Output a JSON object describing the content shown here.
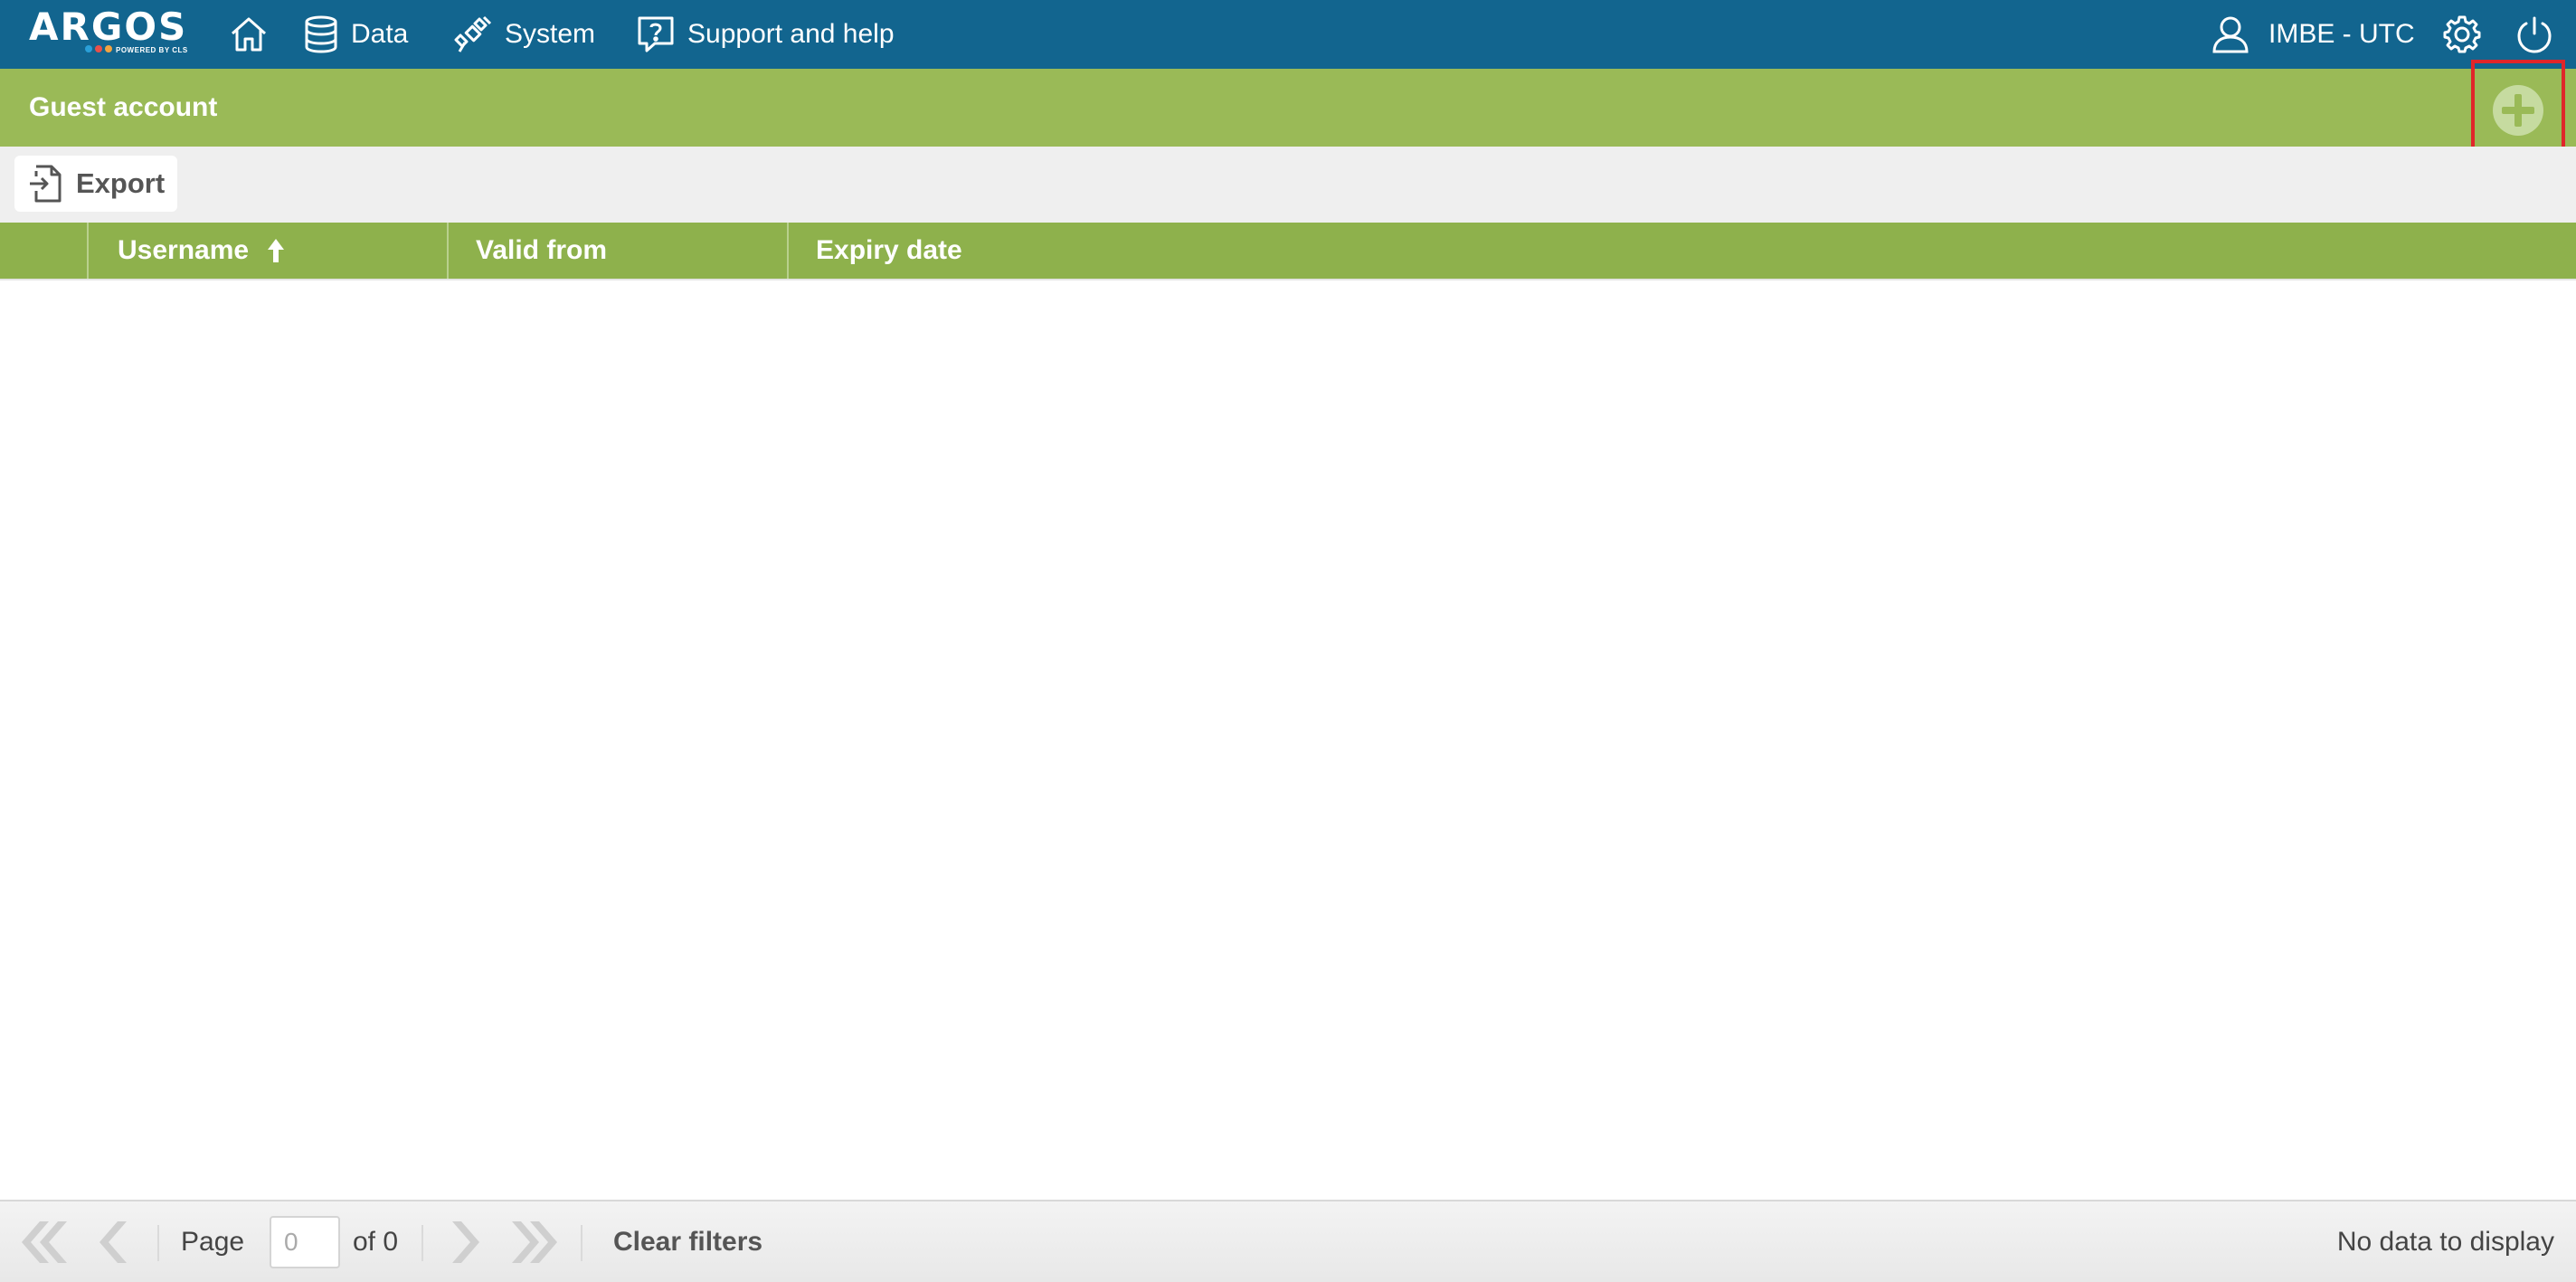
{
  "app": {
    "logo_text": "ARGOS",
    "logo_tagline": "POWERED BY CLS",
    "logo_dot_colors": [
      "#2a9fd8",
      "#e8504a",
      "#f2a341",
      "#7cc25b"
    ]
  },
  "nav": {
    "home_icon": "home-icon",
    "data_label": "Data",
    "data_icon": "database-icon",
    "system_label": "System",
    "system_icon": "satellite-icon",
    "support_label": "Support and help",
    "support_icon": "help-icon",
    "user_label": "IMBE - UTC",
    "user_icon": "user-icon",
    "settings_icon": "gear-icon",
    "logout_icon": "power-icon"
  },
  "page": {
    "title": "Guest account",
    "add_icon": "plus-circle-icon",
    "highlight_color": "#e0262a"
  },
  "toolbar": {
    "export_label": "Export",
    "export_icon": "export-icon"
  },
  "grid": {
    "columns": [
      {
        "label": "Username",
        "sort": "ascending"
      },
      {
        "label": "Valid from"
      },
      {
        "label": "Expiry date"
      }
    ],
    "rows": [],
    "header_color": "#8eb14c"
  },
  "pager": {
    "page_label": "Page",
    "page_value": "0",
    "of_label": "of 0",
    "clear_filters_label": "Clear filters",
    "status_text": "No data to display"
  },
  "colors": {
    "navbar": "#12658f",
    "titlebar": "#9aba57"
  }
}
